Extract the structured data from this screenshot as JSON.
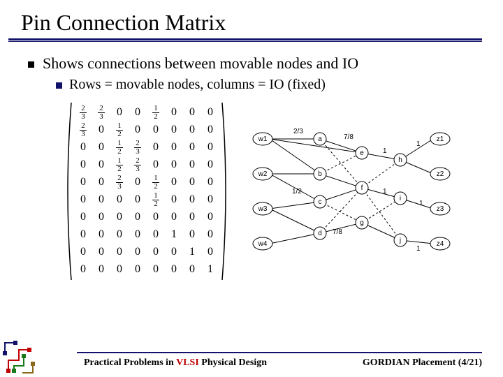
{
  "title": "Pin Connection Matrix",
  "bullets": {
    "l1": "Shows connections between movable nodes and IO",
    "l2": "Rows = movable nodes, columns = IO (fixed)"
  },
  "matrix": {
    "rows": 10,
    "cols": 8,
    "data": [
      [
        "2/3",
        "2/3",
        "0",
        "0",
        "1/2",
        "0",
        "0",
        "0"
      ],
      [
        "2/3",
        "0",
        "1/2",
        "0",
        "0",
        "0",
        "0",
        "0"
      ],
      [
        "0",
        "0",
        "1/2",
        "2/3",
        "0",
        "0",
        "0",
        "0"
      ],
      [
        "0",
        "0",
        "1/2",
        "2/3",
        "0",
        "0",
        "0",
        "0"
      ],
      [
        "0",
        "0",
        "2/3",
        "0",
        "1/2",
        "0",
        "0",
        "0"
      ],
      [
        "0",
        "0",
        "0",
        "0",
        "1/2",
        "0",
        "0",
        "0"
      ],
      [
        "0",
        "0",
        "0",
        "0",
        "0",
        "0",
        "0",
        "0"
      ],
      [
        "0",
        "0",
        "0",
        "0",
        "0",
        "1",
        "0",
        "0"
      ],
      [
        "0",
        "0",
        "0",
        "0",
        "0",
        "0",
        "1",
        "0"
      ],
      [
        "0",
        "0",
        "0",
        "0",
        "0",
        "0",
        "0",
        "1"
      ]
    ]
  },
  "graph": {
    "left_io": [
      "w1",
      "w2",
      "w3",
      "w4"
    ],
    "right_io": [
      "z1",
      "z2",
      "z3",
      "z4"
    ],
    "nodes": [
      "a",
      "b",
      "c",
      "d",
      "e",
      "f",
      "g",
      "h",
      "i",
      "j"
    ],
    "edge_labels": [
      "2/3",
      "7/8",
      "1/2",
      "7/8",
      "1",
      "1",
      "1",
      "1",
      "1"
    ]
  },
  "footer": {
    "left_pre": "Practical Problems in ",
    "left_vlsi": "VLSI",
    "left_post": " Physical Design",
    "right": "GORDIAN Placement (4/21)"
  }
}
